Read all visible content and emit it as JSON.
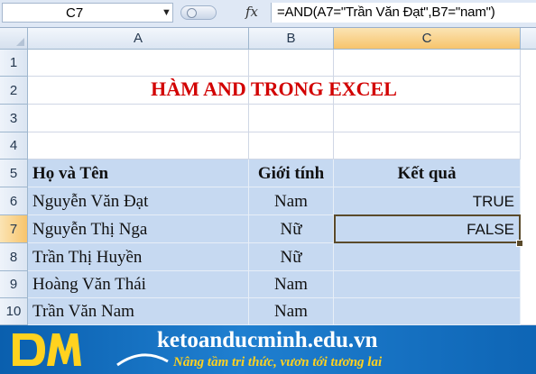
{
  "formula_bar": {
    "name_box": "C7",
    "fx_label": "fx",
    "formula": "=AND(A7=\"Trần Văn Đạt\",B7=\"nam\")"
  },
  "columns": [
    "A",
    "B",
    "C"
  ],
  "rows": [
    "1",
    "2",
    "3",
    "4",
    "5",
    "6",
    "7",
    "8",
    "9",
    "10"
  ],
  "sheet": {
    "title": "HÀM AND TRONG EXCEL",
    "headers": {
      "name": "Họ và Tên",
      "gender": "Giới tính",
      "result": "Kết quả"
    },
    "records": [
      {
        "name": "Nguyễn Văn Đạt",
        "gender": "Nam",
        "result": "TRUE"
      },
      {
        "name": "Nguyễn Thị Nga",
        "gender": "Nữ",
        "result": "FALSE"
      },
      {
        "name": "Trần Thị Huyền",
        "gender": "Nữ",
        "result": ""
      },
      {
        "name": "Hoàng Văn Thái",
        "gender": "Nam",
        "result": ""
      },
      {
        "name": "Trần Văn Nam",
        "gender": "Nam",
        "result": ""
      }
    ]
  },
  "banner": {
    "website": "ketoanducminh.edu.vn",
    "slogan": "Nâng tầm tri thức, vươn tới tương lai",
    "logo_icon": "dm-logo-icon"
  },
  "colors": {
    "title": "#d20000",
    "table_fill": "#c6d9f1",
    "banner": "#1f7fd0",
    "slogan": "#ffd21f"
  }
}
